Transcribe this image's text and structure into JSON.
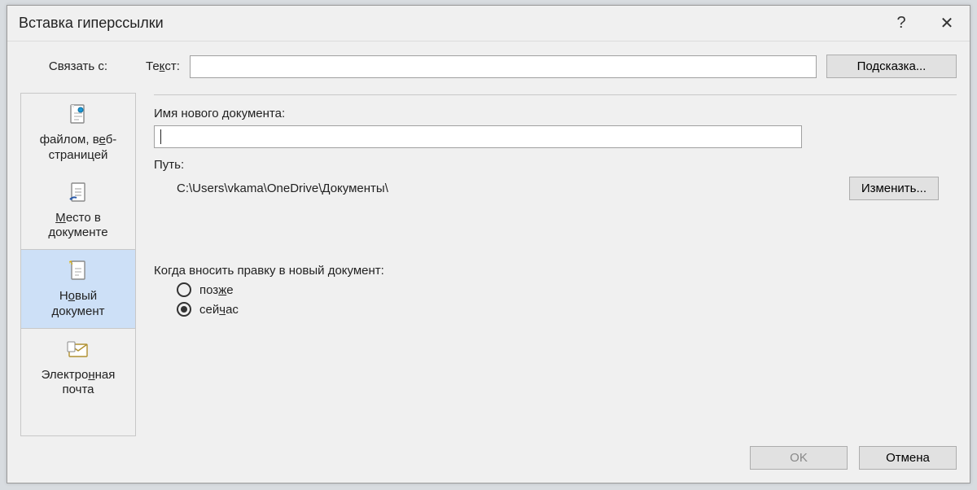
{
  "title": "Вставка гиперссылки",
  "titlebar": {
    "help_tooltip": "?",
    "close_tooltip": "✕"
  },
  "link_with_label": "Связать с:",
  "text_label_pre": "Те",
  "text_label_accel": "к",
  "text_label_post": "ст:",
  "text_value": "",
  "screentip_button": "Подсказка...",
  "sidebar": {
    "items": [
      {
        "line1": "файлом, в",
        "accel": "е",
        "line1b": "б-",
        "line2": "страницей"
      },
      {
        "accel": "М",
        "line1": "есто в",
        "line2": "документе"
      },
      {
        "line1": "Н",
        "accel": "о",
        "line1b": "вый",
        "line2": "документ"
      },
      {
        "line1": "Электро",
        "accel": "н",
        "line1b": "ная",
        "line2": "почта"
      }
    ]
  },
  "content": {
    "name_label": "Имя нового документа:",
    "name_value": "",
    "path_label": "Путь:",
    "path_value": "C:\\Users\\vkama\\OneDrive\\Документы\\",
    "change_button": "Изменить...",
    "when_edit_label": "Когда вносить правку в новый документ:",
    "radio_later_pre": "поз",
    "radio_later_accel": "ж",
    "radio_later_post": "е",
    "radio_now_pre": "сей",
    "radio_now_accel": "ч",
    "radio_now_post": "ас",
    "radio_selected": "now"
  },
  "footer": {
    "ok": "OK",
    "cancel": "Отмена"
  }
}
